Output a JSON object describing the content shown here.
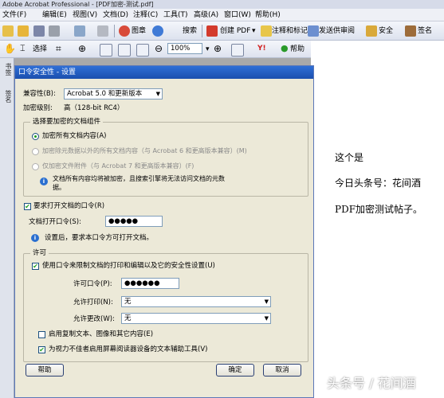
{
  "window": {
    "title": "Adobe Acrobat Professional - [PDF加密-测试.pdf]"
  },
  "menu": [
    "文件(F)",
    "编辑(E)",
    "视图(V)",
    "文档(D)",
    "注释(C)",
    "工具(T)",
    "高级(A)",
    "窗口(W)",
    "帮助(H)"
  ],
  "toolbar1": {
    "seal_label": "图章",
    "search_label": "搜索",
    "create_pdf_label": "创建 PDF",
    "comment_label": "注释和标记",
    "review_label": "发送供审阅",
    "security_label": "安全",
    "sign_label": "签名"
  },
  "toolbar2": {
    "select_label": "选择",
    "zoom_value": "100%",
    "help_label": "帮助"
  },
  "left_nav": {
    "tab1": "书签",
    "tab2": "签名"
  },
  "document": {
    "line1": "这个是",
    "line2": "今日头条号：花间酒",
    "line3": "PDF加密测试帖子。"
  },
  "dialog": {
    "title": "口令安全性 - 设置",
    "compat_label": "兼容性(B):",
    "compat_value": "Acrobat 5.0 和更新版本",
    "encrypt_level_label": "加密级别:",
    "encrypt_level_value": "高（128-bit RC4）",
    "components_group": "选择要加密的文档组件",
    "radio1": "加密所有文档内容(A)",
    "radio2": "加密除元数据以外的所有文档内容（与 Acrobat 6 和更高版本兼容）(M)",
    "radio3": "仅加密文件附件（与 Acrobat 7 和更高版本兼容）(F)",
    "components_info_line1": "文档所有内容均将被加密，且搜索引擎将无法访问文档的元数",
    "components_info_line2": "据。",
    "require_open_label": "要求打开文档的口令(R)",
    "open_password_label": "文档打开口令(S):",
    "open_password_value": "●●●●●",
    "open_info": "设置后，要求本口令方可打开文档。",
    "permissions_group": "许可",
    "restrict_label": "使用口令来限制文档的打印和编辑以及它的安全性设置(U)",
    "permission_password_label": "许可口令(P):",
    "permission_password_value": "●●●●●●",
    "print_label": "允许打印(N):",
    "print_value": "无",
    "change_label": "允许更改(W):",
    "change_value": "无",
    "copy_label": "启用复制文本、图像和其它内容(E)",
    "accessibility_label": "为视力不佳者启用屏幕阅读器设备的文本辅助工具(V)",
    "help_button": "帮助",
    "ok_button": "确定",
    "cancel_button": "取消"
  },
  "watermark": "头条号 / 花间酒"
}
